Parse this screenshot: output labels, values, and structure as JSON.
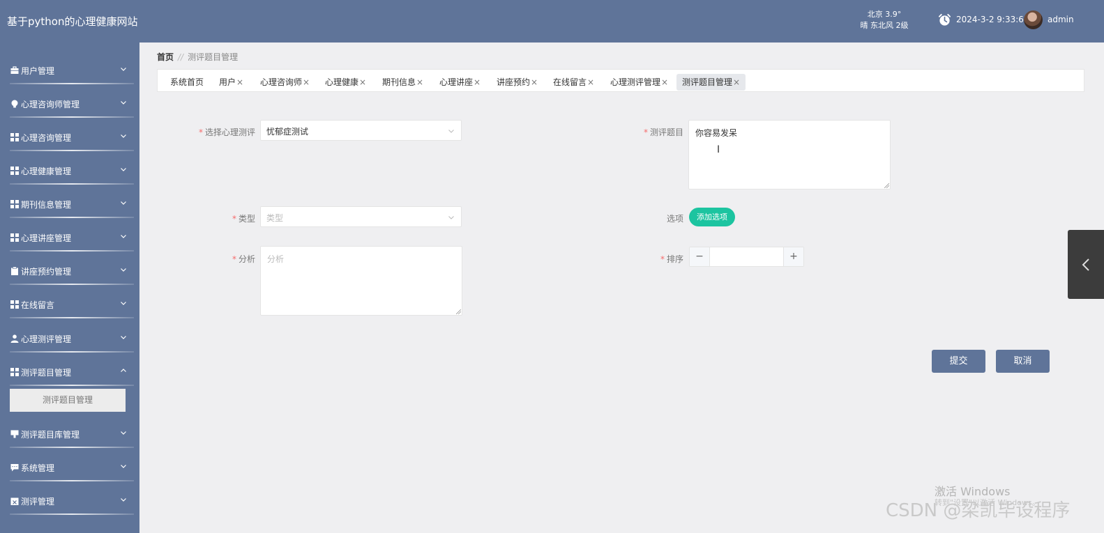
{
  "header": {
    "title": "基于python的心理健康网站",
    "weather_line1": "北京  3.9°",
    "weather_line2": "晴  东北风  2级",
    "datetime": "2024-3-2 9:33:6",
    "username": "admin"
  },
  "sidebar": {
    "items": [
      {
        "label": "用户管理",
        "icon": "briefcase-icon",
        "expanded": false
      },
      {
        "label": "心理咨询师管理",
        "icon": "bulb-icon",
        "expanded": false
      },
      {
        "label": "心理咨询管理",
        "icon": "grid-icon",
        "expanded": false
      },
      {
        "label": "心理健康管理",
        "icon": "grid-icon",
        "expanded": false
      },
      {
        "label": "期刊信息管理",
        "icon": "grid-icon",
        "expanded": false
      },
      {
        "label": "心理讲座管理",
        "icon": "grid-icon",
        "expanded": false
      },
      {
        "label": "讲座预约管理",
        "icon": "clipboard-icon",
        "expanded": false
      },
      {
        "label": "在线留言",
        "icon": "grid-icon",
        "expanded": false
      },
      {
        "label": "心理测评管理",
        "icon": "user-icon",
        "expanded": false
      },
      {
        "label": "测评题目管理",
        "icon": "grid-icon",
        "expanded": true
      },
      {
        "label": "测评题目库管理",
        "icon": "pin-icon",
        "expanded": false
      },
      {
        "label": "系统管理",
        "icon": "chat-icon",
        "expanded": false
      },
      {
        "label": "测评管理",
        "icon": "calendar-x-icon",
        "expanded": false
      }
    ],
    "sub_item": "测评题目管理"
  },
  "breadcrumb": {
    "home": "首页",
    "separator": "//",
    "current": "测评题目管理"
  },
  "tabs": [
    {
      "label": "系统首页",
      "closable": false
    },
    {
      "label": "用户",
      "closable": true
    },
    {
      "label": "心理咨询师",
      "closable": true
    },
    {
      "label": "心理健康",
      "closable": true
    },
    {
      "label": "期刊信息",
      "closable": true
    },
    {
      "label": "心理讲座",
      "closable": true
    },
    {
      "label": "讲座预约",
      "closable": true
    },
    {
      "label": "在线留言",
      "closable": true
    },
    {
      "label": "心理测评管理",
      "closable": true
    },
    {
      "label": "测评题目管理",
      "closable": true,
      "active": true
    }
  ],
  "form": {
    "test_label": "选择心理测评",
    "test_value": "忧郁症测试",
    "question_label": "测评题目",
    "question_value": "你容易发呆",
    "type_label": "类型",
    "type_placeholder": "类型",
    "options_label": "选项",
    "add_option": "添加选项",
    "analysis_label": "分析",
    "analysis_placeholder": "分析",
    "sort_label": "排序",
    "sort_value": "",
    "minus": "−",
    "plus": "+",
    "submit": "提交",
    "cancel": "取消"
  },
  "watermarks": {
    "activate": "激活 Windows",
    "activate_sub": "转到\"设置\"以激活 Windows。",
    "csdn": "CSDN @梁凯毕设程序"
  },
  "colors": {
    "header": "#5f7499",
    "sidebar": "#5f7499",
    "accent": "#1cc4a0",
    "required": "#f56c6c"
  }
}
